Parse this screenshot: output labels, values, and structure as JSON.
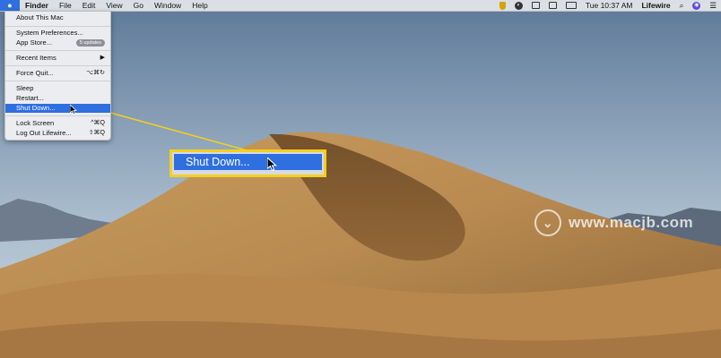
{
  "menubar": {
    "apple_icon": "apple-logo-icon",
    "items": [
      "Finder",
      "File",
      "Edit",
      "View",
      "Go",
      "Window",
      "Help"
    ],
    "clock": "Tue 10:37 AM",
    "user": "Lifewire"
  },
  "apple_menu": {
    "about": "About This Mac",
    "system_prefs": "System Preferences...",
    "app_store": "App Store...",
    "app_store_badge": "5 updates",
    "recent_items": "Recent Items",
    "recent_arrow": "▶",
    "force_quit": "Force Quit...",
    "force_quit_shortcut": "⌥⌘↻",
    "sleep": "Sleep",
    "restart": "Restart...",
    "shut_down": "Shut Down...",
    "lock_screen": "Lock Screen",
    "lock_screen_shortcut": "^⌘Q",
    "log_out": "Log Out Lifewire...",
    "log_out_shortcut": "⇧⌘Q"
  },
  "callout": {
    "label": "Shut Down..."
  },
  "watermark": {
    "text": "www.macjb.com"
  },
  "colors": {
    "highlight": "#2f6fe0",
    "callout_border": "#f4cf1e"
  }
}
